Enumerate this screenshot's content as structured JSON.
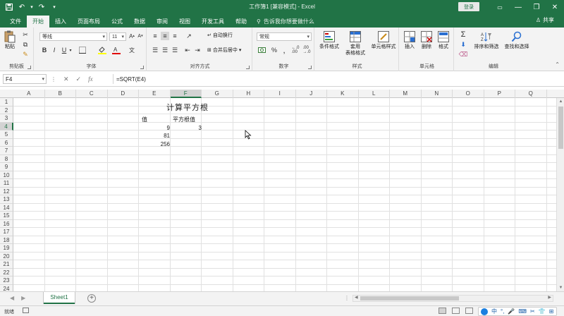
{
  "titlebar": {
    "title": "工作簿1 [兼容模式] - Excel",
    "login": "登录",
    "minimize": "—",
    "restore": "❐",
    "close": "✕"
  },
  "tabs": {
    "items": [
      "文件",
      "开始",
      "插入",
      "页面布局",
      "公式",
      "数据",
      "审阅",
      "视图",
      "开发工具",
      "帮助"
    ],
    "active_index": 1,
    "tellme": "告诉我你想要做什么",
    "share": "共享"
  },
  "ribbon": {
    "clipboard": {
      "label": "剪贴板",
      "paste": "粘贴"
    },
    "font": {
      "label": "字体",
      "font_name": "等线",
      "font_size": "11",
      "bold": "B",
      "italic": "I",
      "underline": "U"
    },
    "alignment": {
      "label": "对齐方式",
      "wrap": "自动换行",
      "merge": "合并后居中"
    },
    "number": {
      "label": "数字",
      "format": "常规",
      "percent": "%"
    },
    "styles": {
      "label": "样式",
      "conditional": "条件格式",
      "table_line1": "套用",
      "table_line2": "表格格式",
      "cell_styles": "单元格样式"
    },
    "cells": {
      "label": "单元格",
      "insert": "插入",
      "delete": "删除",
      "format": "格式"
    },
    "editing": {
      "label": "编辑",
      "sort": "排序和筛选",
      "find": "查找和选择"
    }
  },
  "formulabar": {
    "namebox": "F4",
    "cancel": "✕",
    "enter": "✓",
    "fx": "fx",
    "formula": "=SQRT(E4)"
  },
  "grid": {
    "columns": [
      "A",
      "B",
      "C",
      "D",
      "E",
      "F",
      "G",
      "H",
      "I",
      "J",
      "K",
      "L",
      "M",
      "N",
      "O",
      "P",
      "Q"
    ],
    "rows": [
      "1",
      "2",
      "3",
      "4",
      "5",
      "6",
      "7",
      "8",
      "9",
      "10",
      "11",
      "12",
      "13",
      "14",
      "15",
      "16",
      "17",
      "18",
      "19",
      "20",
      "21",
      "22",
      "23",
      "24"
    ],
    "selected_column": "F",
    "selected_row": "4",
    "cells": {
      "title": "计算平方根",
      "e3": "值",
      "f3": "平方根值",
      "e4": "9",
      "f4": "3",
      "e5": "81",
      "e6": "256"
    }
  },
  "sheets": {
    "tabs": [
      "Sheet1"
    ],
    "add": "+",
    "prev": "◀",
    "next": "▶"
  },
  "status": {
    "ready": "就绪",
    "ime": "中"
  },
  "colors": {
    "brand": "#217346"
  }
}
